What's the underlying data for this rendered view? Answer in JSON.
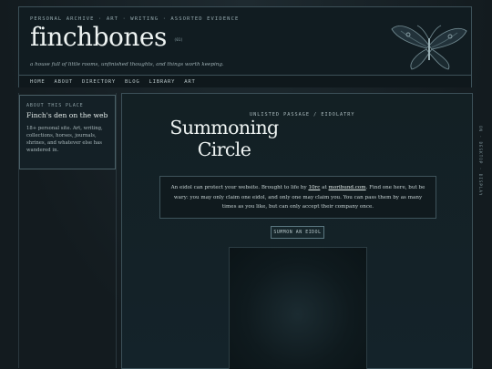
{
  "header": {
    "tagline": "PERSONAL ARCHIVE · ART · WRITING · ASSORTED EVIDENCE",
    "site_title": "finchbones",
    "title_badge": "(01)",
    "subtitle": "a house full of little rooms, unfinished thoughts, and things worth keeping.",
    "moth_icon": "moth-illustration"
  },
  "nav": {
    "items": [
      "HOME",
      "ABOUT",
      "DIRECTORY",
      "BLOG",
      "LIBRARY",
      "ART"
    ]
  },
  "sidebar": {
    "about_label": "ABOUT THIS PLACE",
    "about_title": "Finch's den on the web",
    "about_desc": "18+ personal site. Art, writing, collections, horses, journals, shrines, and whatever else has wandered in."
  },
  "main": {
    "kicker": "UNLISTED PASSAGE / EIDOLATRY",
    "heading": "Summoning Circle",
    "info": {
      "part1": "An eidol can protect your website. Brought to life by ",
      "link1": "10rc",
      "part2": " at ",
      "link2": "moribund.com",
      "part3": ". Find one here, but be wary: you may only claim one eidol, and only one may claim you. You can pass them by as many times as you like, but can only accept their company once."
    },
    "summon_button": "SUMMON AN EIDOL"
  },
  "side_vertical": "ON · DESKTOP · DISPLAY",
  "colors": {
    "background": "#161e22",
    "panel": "#111c21",
    "border": "#3c5058",
    "text_primary": "#eef3f2"
  }
}
